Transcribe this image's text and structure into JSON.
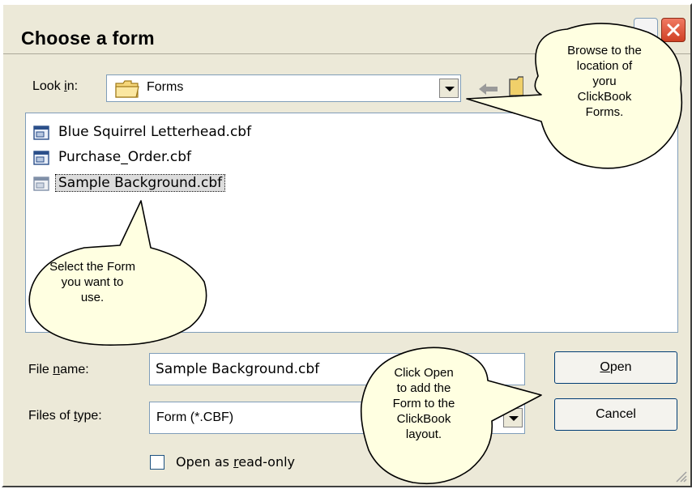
{
  "window": {
    "title": "Choose a form",
    "help_icon": "help-icon",
    "close_icon": "close-icon"
  },
  "look_in": {
    "label_pre": "Look ",
    "label_accel": "i",
    "label_post": "n:",
    "value": "Forms",
    "icon": "folder-icon"
  },
  "toolbar": {
    "back_icon": "back-arrow-icon",
    "up_icon": "up-folder-icon"
  },
  "files": [
    {
      "name": "Blue Squirrel Letterhead.cbf",
      "icon": "cbf-file-icon"
    },
    {
      "name": "Purchase_Order.cbf",
      "icon": "cbf-file-icon"
    },
    {
      "name": "Sample Background.cbf",
      "icon": "cbf-file-icon",
      "selected": true
    }
  ],
  "file_name": {
    "label_pre": "File ",
    "label_accel": "n",
    "label_post": "ame:",
    "value": "Sample Background.cbf"
  },
  "file_type": {
    "label_pre": "Files of ",
    "label_accel": "t",
    "label_post": "ype:",
    "value": "Form (*.CBF)"
  },
  "buttons": {
    "open_accel": "O",
    "open_rest": "pen",
    "cancel": "Cancel"
  },
  "read_only": {
    "label_pre": "Open as ",
    "label_accel": "r",
    "label_post": "ead-only",
    "checked": false
  },
  "callouts": {
    "browse": [
      "Browse to the",
      "location of",
      "yoru",
      "ClickBook",
      "Forms."
    ],
    "select": [
      "Select the Form",
      "you want to",
      "use."
    ],
    "open": [
      "Click Open",
      "to add the",
      "Form to the",
      "ClickBook",
      "layout."
    ]
  },
  "colors": {
    "dialog_bg": "#ece9d8",
    "callout_bg": "#ffffe1",
    "close_button": "#d04125",
    "selection_bg": "#dcdcdc"
  }
}
